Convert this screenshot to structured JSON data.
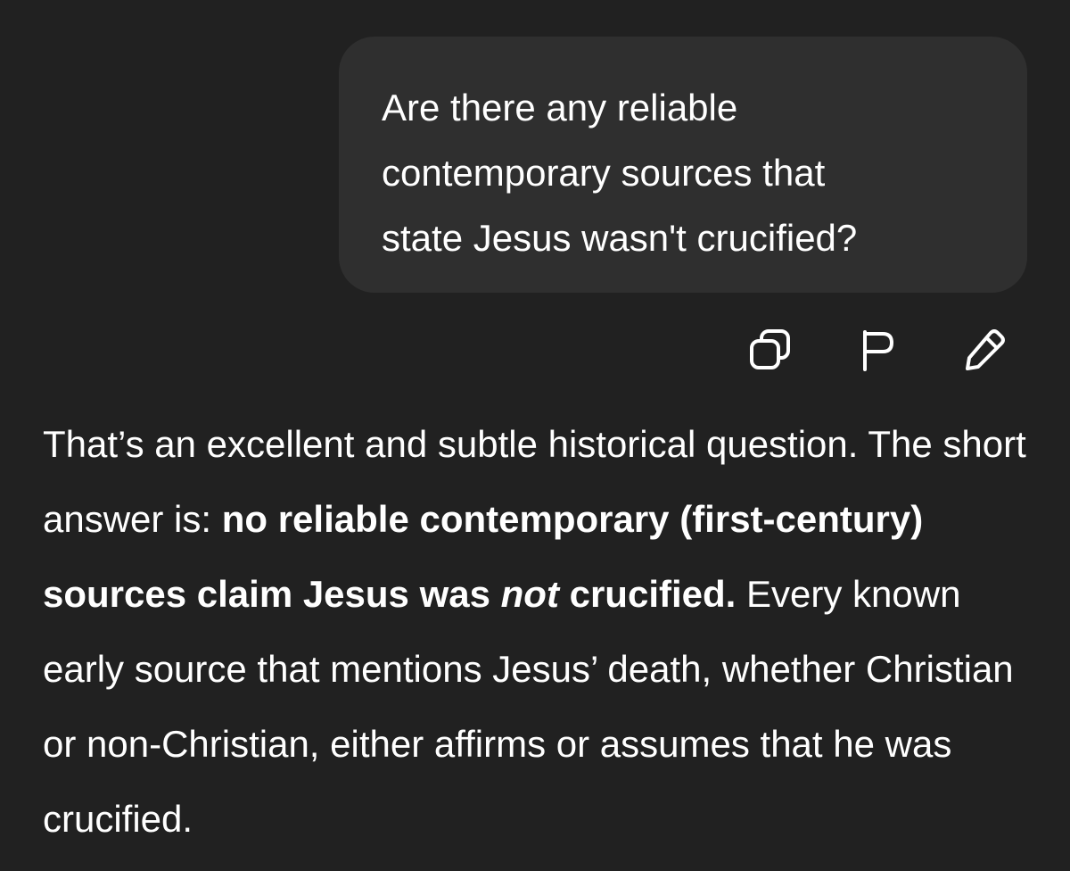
{
  "user_message": {
    "text": "Are there any reliable\ncontemporary sources that\nstate Jesus wasn't crucified?"
  },
  "message_actions": [
    {
      "name": "copy",
      "icon": "copy-icon"
    },
    {
      "name": "flag",
      "icon": "flag-icon"
    },
    {
      "name": "edit",
      "icon": "pencil-icon"
    }
  ],
  "assistant_message": {
    "intro": "That’s an excellent and subtle historical question. The short answer is: ",
    "bold_part1": "no reliable contemporary (first-century) sources claim Jesus was ",
    "bold_italic": "not",
    "bold_part2": " crucified.",
    "rest": " Every known early source that mentions Jesus’ death, whether Christian or non-Christian, either affirms or assumes that he was crucified."
  },
  "colors": {
    "background": "#212121",
    "bubble": "#2f2f2f",
    "text": "#ffffff"
  }
}
